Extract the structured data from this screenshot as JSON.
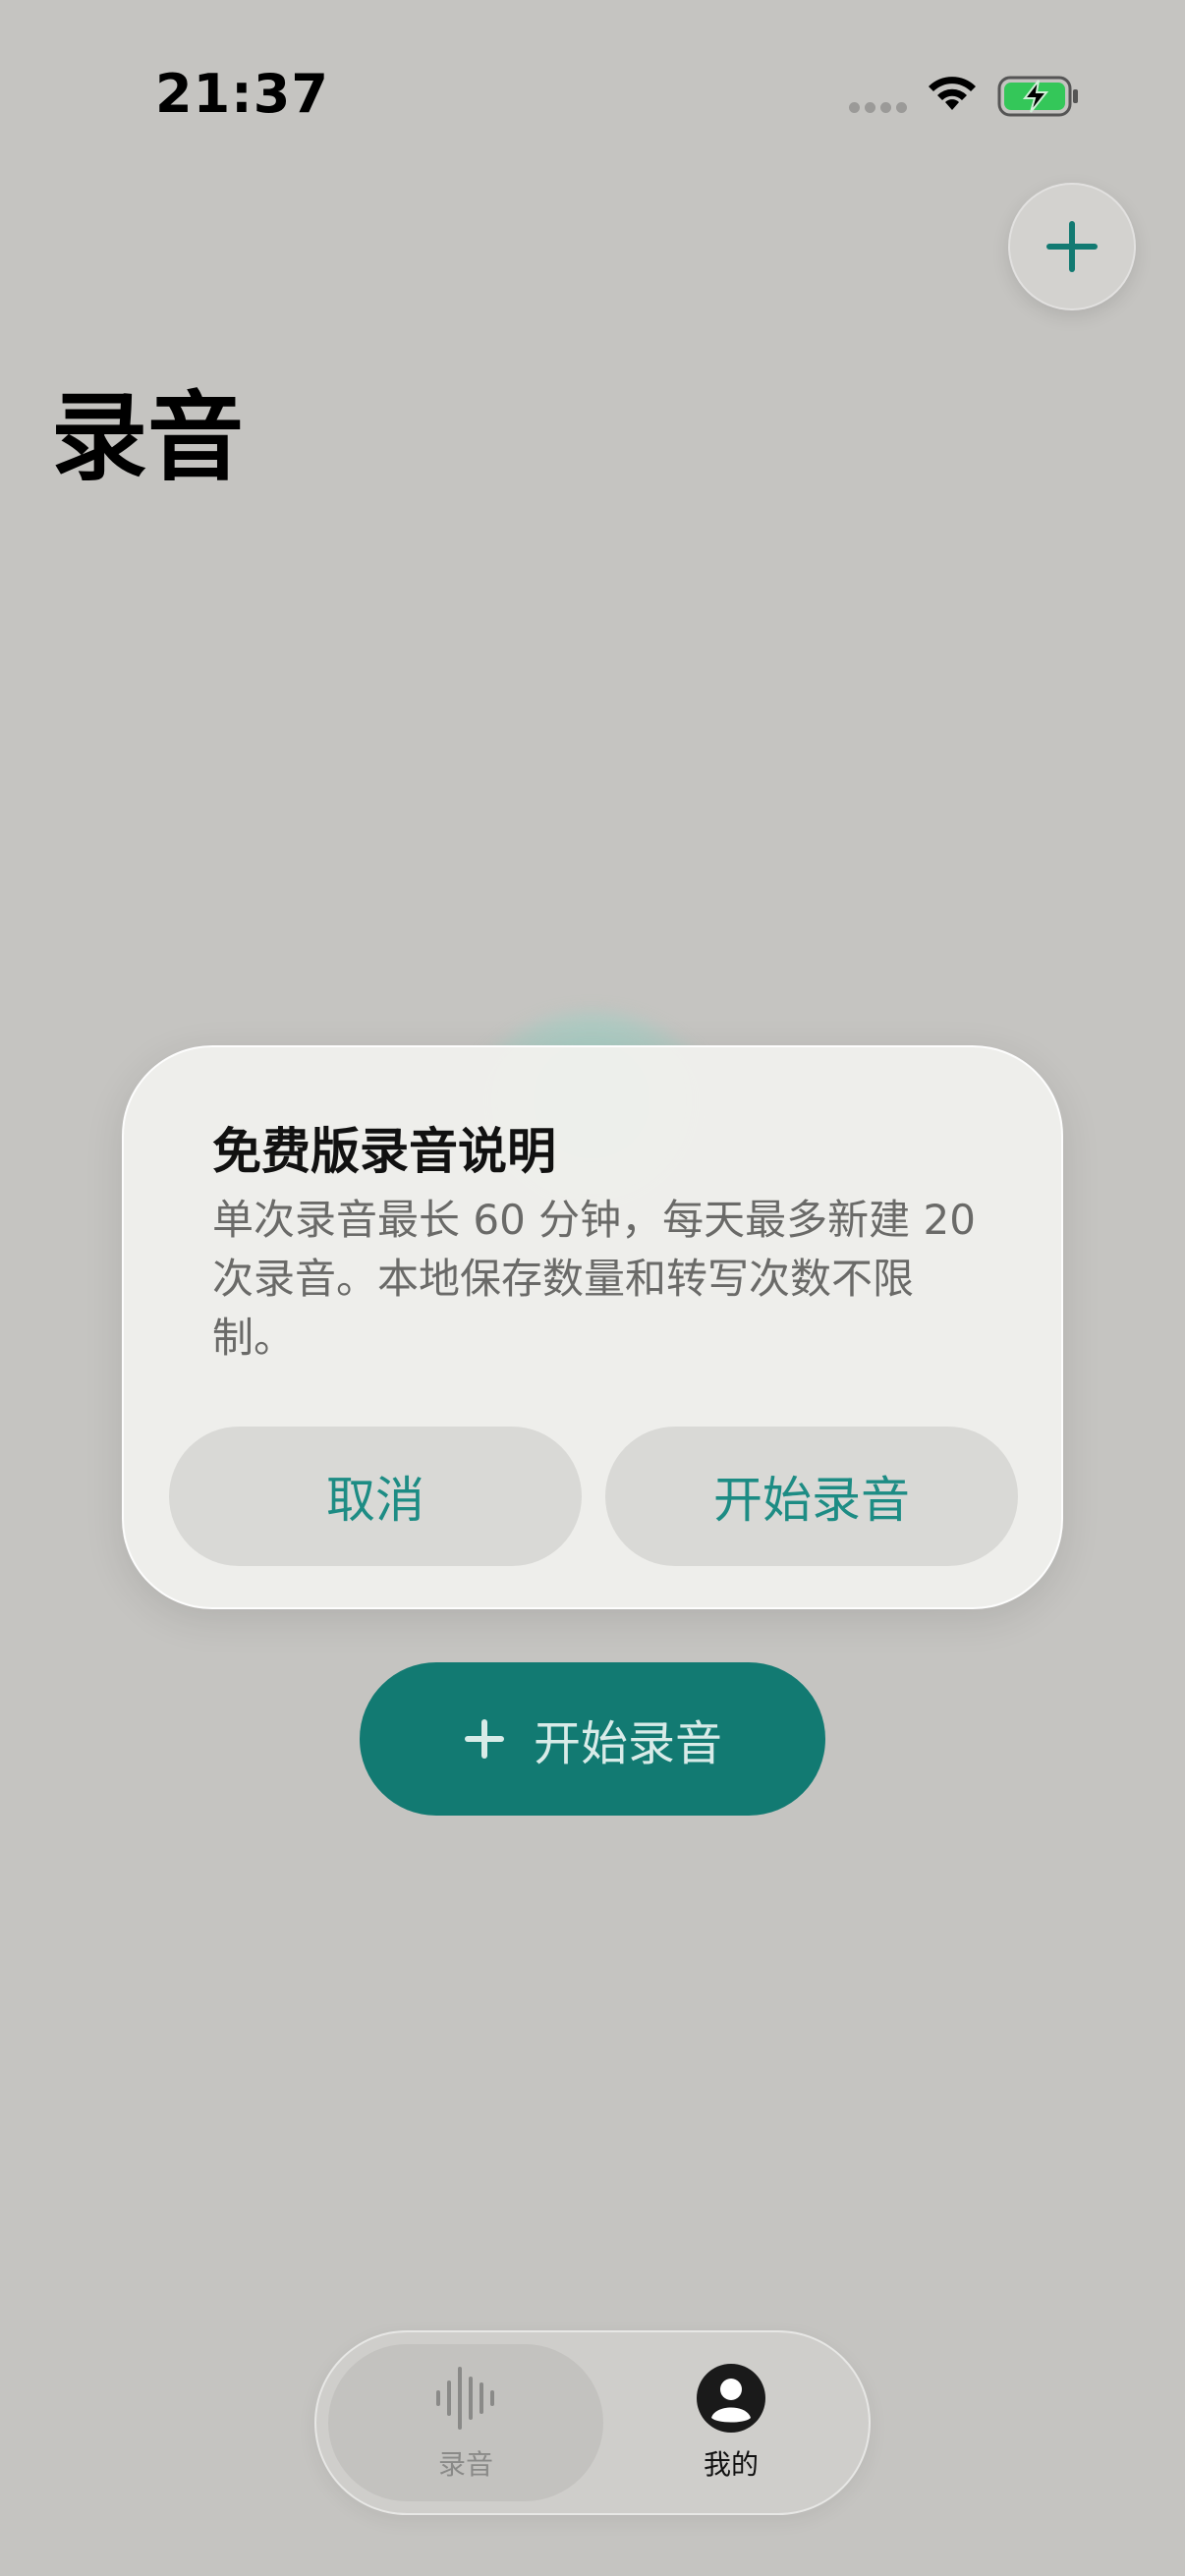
{
  "status_bar": {
    "time": "21:37",
    "battery_color": "#34c759"
  },
  "header": {
    "title": "录音",
    "add_icon": "plus-icon"
  },
  "main": {
    "start_button_label": "开始录音"
  },
  "dialog": {
    "title": "免费版录音说明",
    "body": "单次录音最长 60 分钟，每天最多新建 20 次录音。本地保存数量和转写次数不限制。",
    "cancel_label": "取消",
    "confirm_label": "开始录音",
    "accent_color": "#1d8c84"
  },
  "tab_bar": {
    "tabs": [
      {
        "label": "录音",
        "icon": "waveform-icon"
      },
      {
        "label": "我的",
        "icon": "person-icon"
      }
    ]
  },
  "colors": {
    "accent": "#127a72",
    "background": "#c5c4c1"
  }
}
